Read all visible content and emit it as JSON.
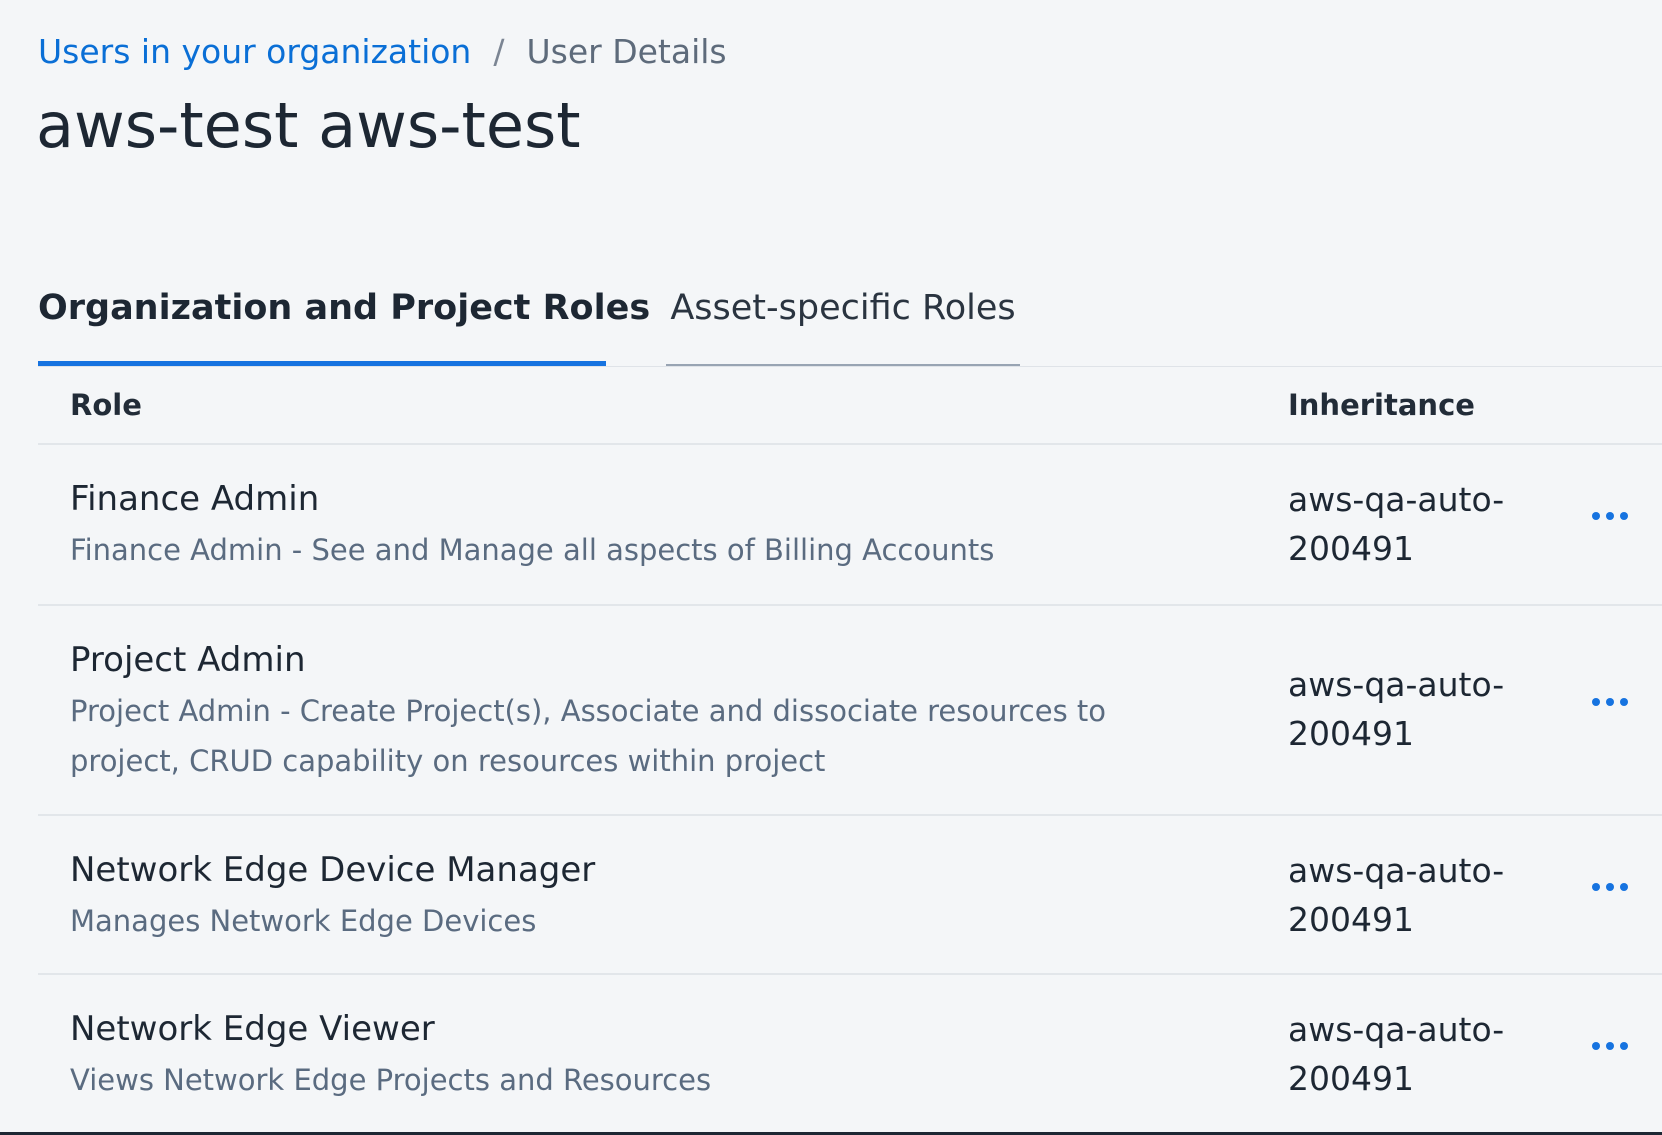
{
  "breadcrumb": {
    "parent_label": "Users in your organization",
    "separator": "/",
    "current_label": "User Details"
  },
  "page": {
    "title": "aws-test aws-test"
  },
  "tabs": [
    {
      "label": "Organization and Project Roles",
      "active": true
    },
    {
      "label": "Asset-specific Roles",
      "active": false
    }
  ],
  "table": {
    "columns": {
      "role": "Role",
      "inheritance": "Inheritance"
    },
    "rows": [
      {
        "name": "Finance Admin",
        "description": "Finance Admin - See and Manage all aspects of Billing Accounts",
        "inheritance": "aws-qa-auto-200491"
      },
      {
        "name": "Project Admin",
        "description": "Project Admin - Create Project(s), Associate and dissociate resources to project, CRUD capability on resources within project",
        "inheritance": "aws-qa-auto-200491"
      },
      {
        "name": "Network Edge Device Manager",
        "description": "Manages Network Edge Devices",
        "inheritance": "aws-qa-auto-200491"
      },
      {
        "name": "Network Edge Viewer",
        "description": "Views Network Edge Projects and Resources",
        "inheritance": "aws-qa-auto-200491"
      }
    ]
  },
  "icons": {
    "row_action": "more-options-icon"
  },
  "colors": {
    "link": "#0a6fd6",
    "accent": "#1673e0",
    "background": "#f4f6f8",
    "text": "#1d2733",
    "muted_text": "#5a6b80"
  }
}
